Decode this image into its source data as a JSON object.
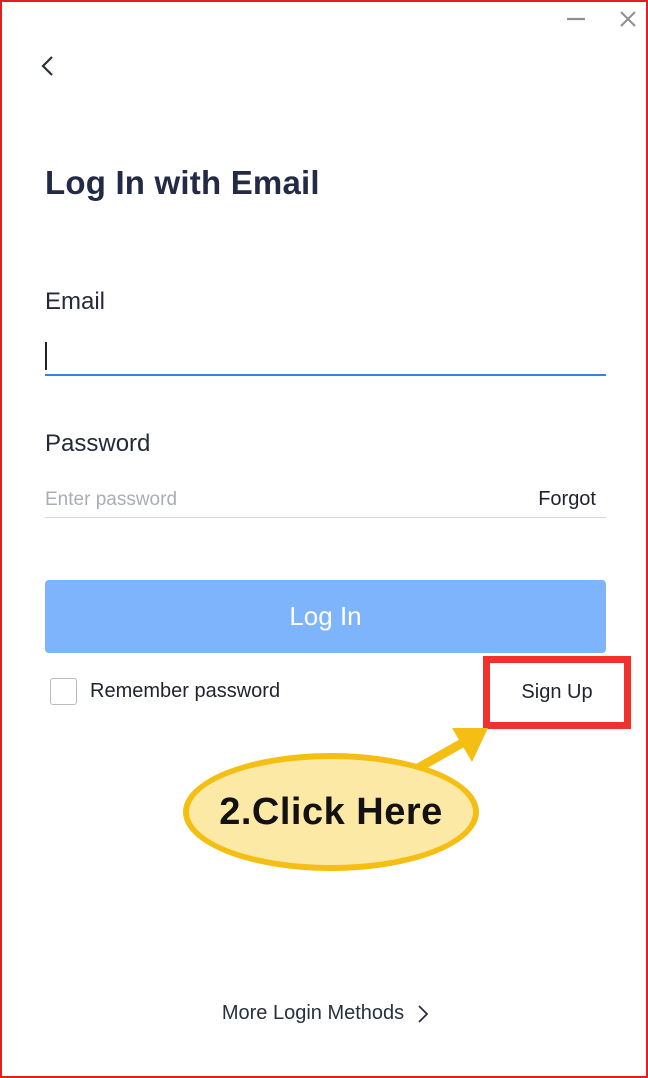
{
  "window": {
    "minimize_icon": "minimize-icon",
    "close_icon": "close-icon",
    "border_color": "#e0201f"
  },
  "header": {
    "back_icon": "chevron-left-icon",
    "title": "Log In with Email"
  },
  "form": {
    "email_label": "Email",
    "email_value": "",
    "password_label": "Password",
    "password_placeholder": "Enter password",
    "password_value": "",
    "forgot_label": "Forgot",
    "login_label": "Log In",
    "login_color": "#7db4fb",
    "remember_label": "Remember password",
    "remember_checked": false,
    "signup_label": "Sign Up"
  },
  "annotation": {
    "callout_text": "2.Click Here",
    "highlight_color": "#f0312e",
    "callout_fill": "#fde9a6",
    "callout_border": "#f4bf12"
  },
  "footer": {
    "more_methods_label": "More Login Methods",
    "more_icon": "chevron-right-icon"
  }
}
